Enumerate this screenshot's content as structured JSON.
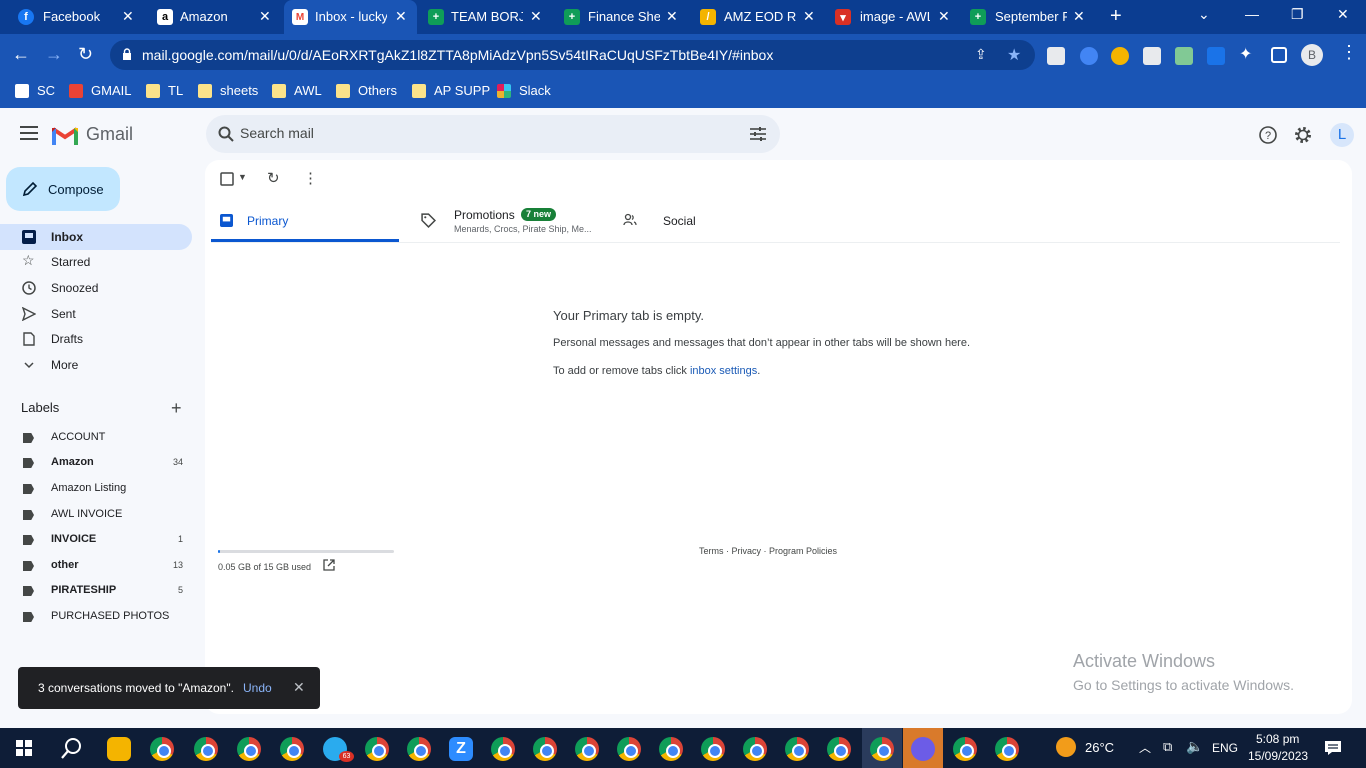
{
  "browser": {
    "tabs": [
      {
        "label": "Facebook",
        "icon": "facebook-icon",
        "color": "#1877f2"
      },
      {
        "label": "Amazon",
        "icon": "amazon-icon",
        "color": "#000000"
      },
      {
        "label": "Inbox - luckyl",
        "icon": "gmail-icon",
        "color": "#ea4335"
      },
      {
        "label": "TEAM BORJ-L",
        "icon": "sheets-icon",
        "color": "#0f9d58"
      },
      {
        "label": "Finance Sheet",
        "icon": "sheets-icon",
        "color": "#0f9d58"
      },
      {
        "label": "AMZ EOD Re",
        "icon": "report-icon",
        "color": "#f4b400"
      },
      {
        "label": "image - AWL",
        "icon": "image-icon",
        "color": "#d93025"
      },
      {
        "label": "September Pr",
        "icon": "sheets-icon",
        "color": "#0f9d58"
      }
    ],
    "url": "mail.google.com/mail/u/0/d/AEoRXRTgAkZ1l8ZTTA8pMiAdzVpn5Sv54tIRaCUqUSFzTbtBe4IY/#inbox",
    "profile_initial": "B",
    "bookmarks": [
      {
        "label": "SC",
        "icon": "amazon-icon"
      },
      {
        "label": "GMAIL",
        "icon": "gmail-icon"
      },
      {
        "label": "TL",
        "icon": "folder-icon"
      },
      {
        "label": "sheets",
        "icon": "folder-icon"
      },
      {
        "label": "AWL",
        "icon": "folder-icon"
      },
      {
        "label": "Others",
        "icon": "folder-icon"
      },
      {
        "label": "AP SUPP",
        "icon": "folder-icon"
      },
      {
        "label": "Slack",
        "icon": "slack-icon"
      }
    ]
  },
  "gmail": {
    "logo_text": "Gmail",
    "search_placeholder": "Search mail",
    "account_initial": "L",
    "compose_label": "Compose",
    "nav": [
      {
        "label": "Inbox",
        "icon": "inbox-icon"
      },
      {
        "label": "Starred",
        "icon": "star-icon"
      },
      {
        "label": "Snoozed",
        "icon": "clock-icon"
      },
      {
        "label": "Sent",
        "icon": "send-icon"
      },
      {
        "label": "Drafts",
        "icon": "draft-icon"
      },
      {
        "label": "More",
        "icon": "chevron-down-icon"
      }
    ],
    "labels_heading": "Labels",
    "labels": [
      {
        "name": "ACCOUNT",
        "count": "",
        "bold": false
      },
      {
        "name": "Amazon",
        "count": "34",
        "bold": true
      },
      {
        "name": "Amazon Listing",
        "count": "",
        "bold": false
      },
      {
        "name": "AWL INVOICE",
        "count": "",
        "bold": false
      },
      {
        "name": "INVOICE",
        "count": "1",
        "bold": true
      },
      {
        "name": "other",
        "count": "13",
        "bold": true
      },
      {
        "name": "PIRATESHIP",
        "count": "5",
        "bold": true
      },
      {
        "name": "PURCHASED PHOTOS",
        "count": "",
        "bold": false
      }
    ],
    "tabs": {
      "primary": "Primary",
      "promotions": "Promotions",
      "promotions_badge": "7 new",
      "promotions_sub": "Menards, Crocs, Pirate Ship, Me...",
      "social": "Social"
    },
    "empty": {
      "title": "Your Primary tab is empty.",
      "description": "Personal messages and messages that don’t appear in other tabs will be shown here.",
      "settings_prefix": "To add or remove tabs click ",
      "settings_link": "inbox settings",
      "settings_suffix": "."
    },
    "storage": {
      "text": "0.05 GB of 15 GB used",
      "fraction": 0.0033
    },
    "footer": "Terms · Privacy · Program Policies",
    "snackbar": {
      "message": "3 conversations moved to \"Amazon\".",
      "action": "Undo"
    }
  },
  "watermark": {
    "title": "Activate Windows",
    "subtitle": "Go to Settings to activate Windows."
  },
  "taskbar": {
    "temperature": "26°C",
    "language": "ENG",
    "time": "5:08 pm",
    "date": "15/09/2023",
    "telegram_badge": "63"
  }
}
